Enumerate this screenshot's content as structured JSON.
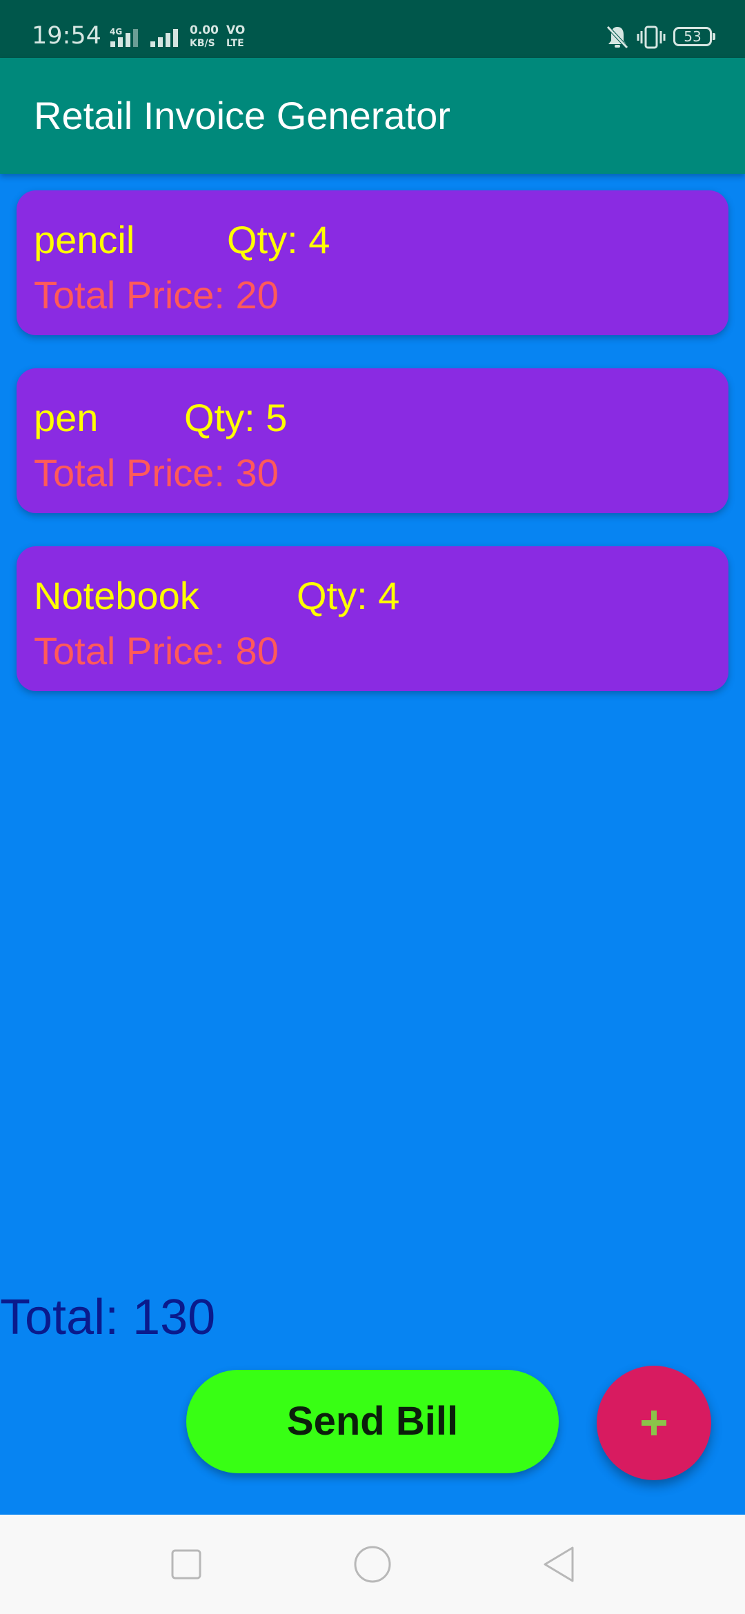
{
  "status_bar": {
    "time": "19:54",
    "network_type": "4G",
    "data_speed_value": "0.00",
    "data_speed_unit": "KB/S",
    "volte_top": "VO",
    "volte_bottom": "LTE",
    "battery": "53"
  },
  "app_bar": {
    "title": "Retail Invoice Generator"
  },
  "items": [
    {
      "name": "pencil",
      "qty": "Qty: 4",
      "total": "Total Price: 20"
    },
    {
      "name": "pen",
      "qty": "Qty: 5",
      "total": "Total Price: 30"
    },
    {
      "name": "Notebook",
      "qty": "Qty: 4",
      "total": "Total Price: 80"
    }
  ],
  "footer": {
    "grand_total": "Total: 130",
    "send_bill_label": "Send Bill",
    "add_button_symbol": "+"
  },
  "colors": {
    "background": "#0784f2",
    "status_bar": "#00574b",
    "app_bar": "#00897b",
    "card": "#8a2be2",
    "item_text": "#ffff00",
    "price_text": "#ff5a5a",
    "total_text": "#0a1a8c",
    "send_button": "#38ff14",
    "fab": "#d81b60",
    "fab_icon": "#8bc34a"
  },
  "icons": {
    "status": [
      "signal-icon",
      "mute-icon",
      "vibrate-icon",
      "battery-icon"
    ],
    "fab": "plus-icon",
    "nav": [
      "recents-square-icon",
      "home-circle-icon",
      "back-triangle-icon"
    ]
  }
}
